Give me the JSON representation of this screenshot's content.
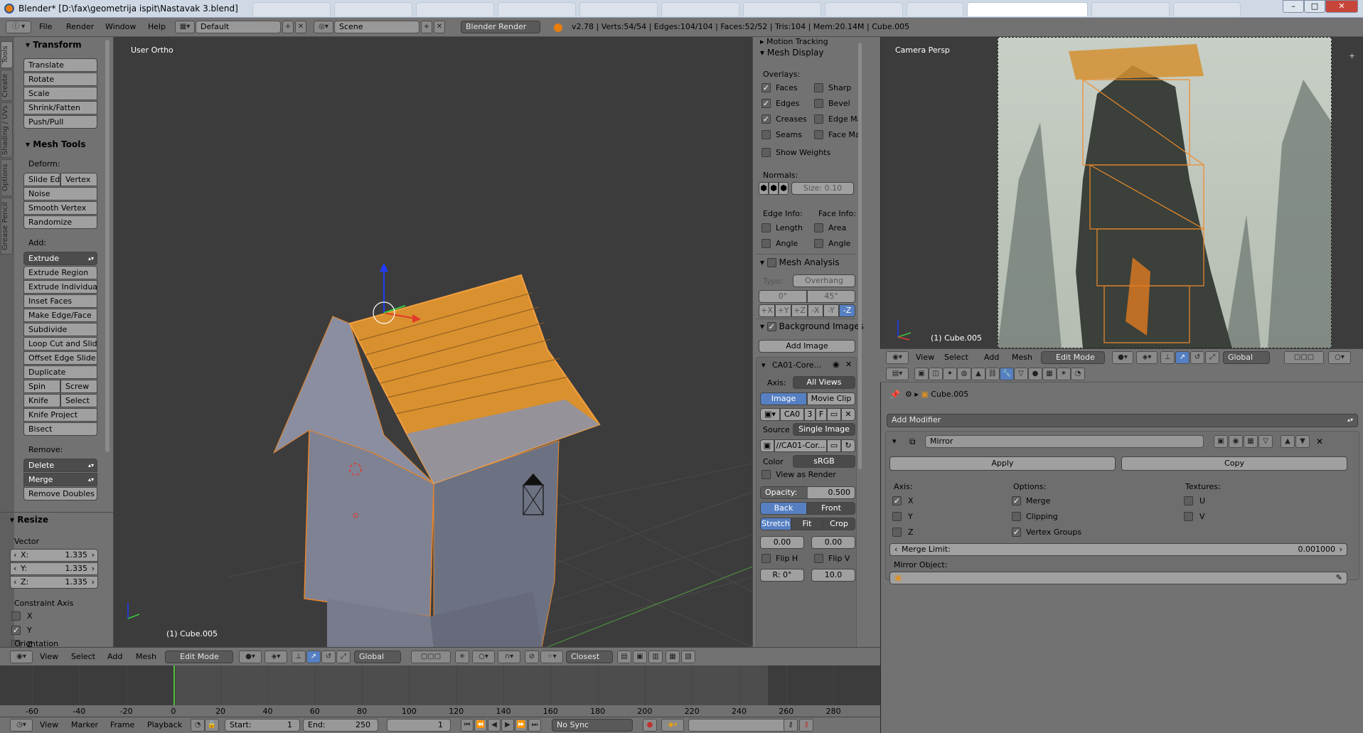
{
  "window": {
    "title": "Blender* [D:\\fax\\geometrija ispit\\Nastavak 3.blend]",
    "minimize": "–",
    "maximize": "□",
    "close": "✕"
  },
  "info_header": {
    "menus": [
      "File",
      "Render",
      "Window",
      "Help"
    ],
    "layout": "Default",
    "scene": "Scene",
    "engine": "Blender Render",
    "stats": "v2.78 | Verts:54/54 | Edges:104/104 | Faces:52/52 | Tris:104 | Mem:20.14M | Cube.005"
  },
  "toolshelf": {
    "tabs": [
      "Tools",
      "Create",
      "Shading / UVs",
      "Options",
      "Grease Pencil"
    ],
    "transform": {
      "title": "Transform",
      "buttons": [
        "Translate",
        "Rotate",
        "Scale",
        "Shrink/Fatten",
        "Push/Pull"
      ]
    },
    "mesh_tools": {
      "title": "Mesh Tools",
      "deform_label": "Deform:",
      "slide_edge": "Slide Ed",
      "vertex": "Vertex",
      "deform_buttons": [
        "Noise",
        "Smooth Vertex",
        "Randomize"
      ],
      "add_label": "Add:",
      "extrude": "Extrude",
      "add_buttons": [
        "Extrude Region",
        "Extrude Individual",
        "Inset Faces",
        "Make Edge/Face",
        "Subdivide",
        "Loop Cut and Slide",
        "Offset Edge Slide",
        "Duplicate"
      ],
      "spin": "Spin",
      "screw": "Screw",
      "knife": "Knife",
      "select": "Select",
      "knife_project": "Knife Project",
      "bisect": "Bisect",
      "remove_label": "Remove:",
      "delete": "Delete",
      "merge": "Merge",
      "remove_doubles": "Remove Doubles"
    },
    "resize": {
      "title": "Resize",
      "vector_label": "Vector",
      "x_label": "X:",
      "x": "1.335",
      "y_label": "Y:",
      "y": "1.335",
      "z_label": "Z:",
      "z": "1.335",
      "constraint_label": "Constraint Axis",
      "cx": "X",
      "cy": "Y",
      "cz": "Z",
      "orientation_label": "Orientation"
    }
  },
  "viewport": {
    "label": "User Ortho",
    "object": "(1) Cube.005"
  },
  "npanel": {
    "motion_tracking": "Motion Tracking",
    "mesh_display": {
      "title": "Mesh Display",
      "overlays_label": "Overlays:",
      "faces": "Faces",
      "sharp": "Sharp",
      "edges": "Edges",
      "bevel": "Bevel",
      "creases": "Creases",
      "edge_marks": "Edge Ma",
      "seams": "Seams",
      "face_marks": "Face Ma",
      "show_weights": "Show Weights",
      "normals_label": "Normals:",
      "size": "Size:",
      "size_value": "0.10",
      "edge_info": "Edge Info:",
      "face_info": "Face Info:",
      "length": "Length",
      "area": "Area",
      "angle": "Angle",
      "angle2": "Angle"
    },
    "mesh_analysis": {
      "title": "Mesh Analysis",
      "type_label": "Type:",
      "type": "Overhang",
      "min": "0°",
      "max": "45°",
      "axes": [
        "+X",
        "+Y",
        "+Z",
        "-X",
        "-Y",
        "-Z"
      ]
    },
    "bg_images": {
      "title": "Background Images",
      "add_image": "Add Image",
      "image_name": "CA01-Core...",
      "axis_label": "Axis:",
      "axis": "All Views",
      "image_tab": "Image",
      "movie_clip_tab": "Movie Clip",
      "img_short": "CA0",
      "users": "3",
      "fake": "F",
      "source_label": "Source",
      "source": "Single Image",
      "path": "//CA01-Cor...",
      "color_label": "Color",
      "color": "sRGB",
      "view_as_render": "View as Render",
      "opacity_label": "Opacity:",
      "opacity": "0.500",
      "back": "Back",
      "front": "Front",
      "stretch": "Stretch",
      "fit": "Fit",
      "crop": "Crop",
      "offset_x": "0.00",
      "offset_y": "0.00",
      "flip_h": "Flip H",
      "flip_v": "Flip V",
      "rotation": "R: 0°",
      "size": "10.0"
    }
  },
  "viewport_header": {
    "menus": [
      "View",
      "Select",
      "Add",
      "Mesh"
    ],
    "mode": "Edit Mode",
    "orientation": "Global",
    "snap": "Closest"
  },
  "timeline": {
    "ticks": [
      "-60",
      "-40",
      "-20",
      "0",
      "20",
      "40",
      "60",
      "80",
      "100",
      "120",
      "140",
      "160",
      "180",
      "200",
      "220",
      "240",
      "260",
      "280"
    ],
    "current_frame_fraction": 0.0,
    "menus": [
      "View",
      "Marker",
      "Frame",
      "Playback"
    ],
    "start_label": "Start:",
    "start": "1",
    "end_label": "End:",
    "end": "250",
    "current": "1",
    "sync": "No Sync"
  },
  "camera_view": {
    "label": "Camera Persp",
    "object": "(1) Cube.005",
    "menus": [
      "View",
      "Select",
      "Add",
      "Mesh"
    ],
    "mode": "Edit Mode",
    "orientation": "Global"
  },
  "properties": {
    "object": "Cube.005",
    "add_modifier": "Add Modifier",
    "modifier_name": "Mirror",
    "apply": "Apply",
    "copy": "Copy",
    "axis_label": "Axis:",
    "options_label": "Options:",
    "textures_label": "Textures:",
    "ax": "X",
    "ay": "Y",
    "az": "Z",
    "merge": "Merge",
    "clipping": "Clipping",
    "vertex_groups": "Vertex Groups",
    "tu": "U",
    "tv": "V",
    "merge_limit_label": "Merge Limit:",
    "merge_limit": "0.001000",
    "mirror_object_label": "Mirror Object:"
  },
  "colors": {
    "selection": "#f0922b",
    "panel": "#727272",
    "viewport_bg": "#3c3c3c",
    "active_blue": "#5680c2"
  }
}
